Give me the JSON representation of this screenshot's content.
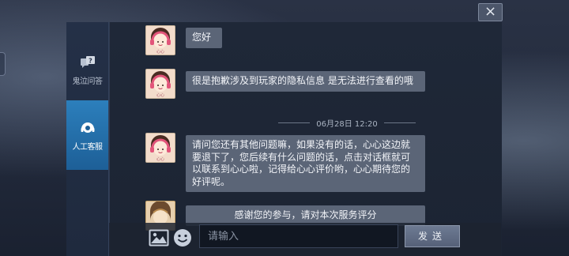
{
  "window": {
    "close_label": "×"
  },
  "sidebar": {
    "items": [
      {
        "label": "鬼泣问答",
        "icon": "qa-icon",
        "active": false
      },
      {
        "label": "人工客服",
        "icon": "headset-icon",
        "active": true
      }
    ]
  },
  "chat": {
    "messages": [
      {
        "text": "您好",
        "avatar": "pink-headphone-avatar"
      },
      {
        "text": "很是抱歉涉及到玩家的隐私信息 是无法进行查看的哦",
        "avatar": "pink-headphone-avatar"
      },
      {
        "text": "请问您还有其他问题嘛，如果没有的话，心心这边就要退下了，您后续有什么问题的话，点击对话框就可以联系到心心啦，记得给心心评价哟，心心期待您的好评呢。",
        "avatar": "pink-headphone-avatar"
      },
      {
        "text": "感谢您的参与，请对本次服务评分",
        "avatar": "gold-avatar"
      }
    ],
    "timestamp": "06月28日 12:20"
  },
  "input_bar": {
    "placeholder": "请输入",
    "send_label": "发送"
  },
  "colors": {
    "accent": "#2c7fbc",
    "bubble": "#5b6577",
    "panel": "#1f2838"
  }
}
